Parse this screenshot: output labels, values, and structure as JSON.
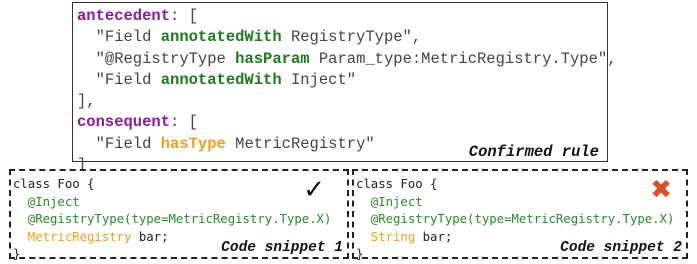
{
  "rule": {
    "line1_key": "antecedent",
    "line1_rest": ": [",
    "line2_a": "  \"Field ",
    "line2_kw": "annotatedWith",
    "line2_b": " RegistryType\",",
    "line3_a": "  \"@RegistryType ",
    "line3_kw": "hasParam",
    "line3_b": " Param_type:MetricRegistry.Type\",",
    "line4_a": "  \"Field ",
    "line4_kw": "annotatedWith",
    "line4_b": " Inject\"",
    "line5": "],",
    "line6_key": "consequent",
    "line6_rest": ": [",
    "line7_a": "  \"Field ",
    "line7_kw": "hasType",
    "line7_b": " MetricRegistry\"",
    "line8": "]",
    "caption": "Confirmed rule"
  },
  "snippet1": {
    "line1": "class Foo {",
    "line2": "  @Inject",
    "line3_a": "  @RegistryType(",
    "line3_b": "type=MetricRegistry.Type.X)",
    "line4_type": "  MetricRegistry",
    "line4_rest": " bar;",
    "line5": "}",
    "mark": "✓",
    "caption": "Code snippet 1"
  },
  "snippet2": {
    "line1": "class Foo {",
    "line2": "  @Inject",
    "line3_a": "  @RegistryType(",
    "line3_b": "type=MetricRegistry.Type.X)",
    "line4_type": "  String",
    "line4_rest": " bar;",
    "line5": "}",
    "mark": "✖",
    "caption": "Code snippet 2"
  }
}
